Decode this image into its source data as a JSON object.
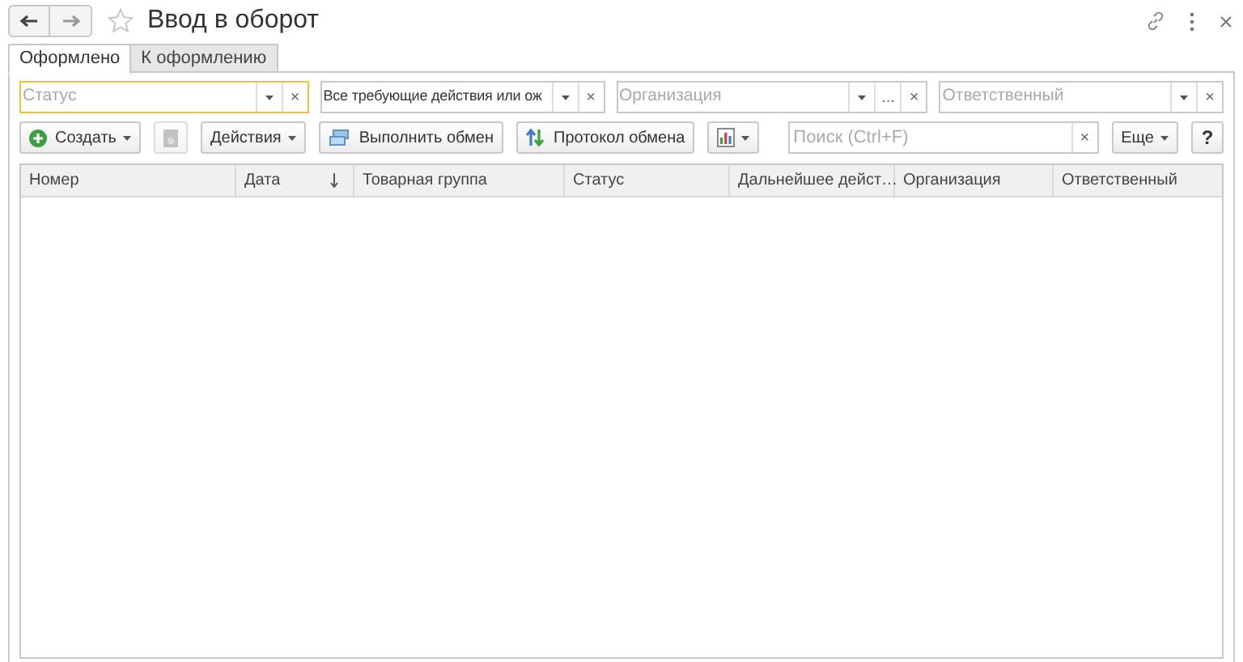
{
  "window": {
    "title": "Ввод в оборот"
  },
  "tabs": [
    {
      "label": "Оформлено",
      "selected": true
    },
    {
      "label": "К оформлению",
      "selected": false
    }
  ],
  "filters": [
    {
      "placeholder": "Статус",
      "focused": true,
      "buttons": [
        {
          "kind": "dropdown"
        },
        {
          "kind": "clear",
          "label": "×"
        }
      ]
    },
    {
      "value": "Все требующие действия или ож",
      "focused": false,
      "buttons": [
        {
          "kind": "dropdown"
        },
        {
          "kind": "clear",
          "label": "×"
        }
      ]
    },
    {
      "placeholder": "Организация",
      "focused": false,
      "buttons": [
        {
          "kind": "dropdown"
        },
        {
          "kind": "choose",
          "label": "..."
        },
        {
          "kind": "clear",
          "label": "×"
        }
      ]
    },
    {
      "placeholder": "Ответственный",
      "focused": false,
      "buttons": [
        {
          "kind": "dropdown"
        },
        {
          "kind": "clear",
          "label": "×"
        }
      ]
    }
  ],
  "toolbar": [
    {
      "kind": "create",
      "label": "Создать",
      "menu": true
    },
    {
      "kind": "copy",
      "disabled": true
    },
    {
      "kind": "text",
      "label": "Действия",
      "menu": true
    },
    {
      "kind": "exchange",
      "label": "Выполнить обмен"
    },
    {
      "kind": "protocol",
      "label": "Протокол обмена"
    },
    {
      "kind": "report",
      "menu": true
    },
    {
      "kind": "search",
      "placeholder": "Поиск (Ctrl+F)",
      "clear": "×"
    },
    {
      "kind": "text",
      "label": "Еще",
      "menu": true
    },
    {
      "kind": "help",
      "label": "?"
    }
  ],
  "table": {
    "columns": [
      {
        "label": "Номер",
        "sorted": false
      },
      {
        "label": "Дата",
        "sorted": true
      },
      {
        "label": "Товарная группа",
        "sorted": false
      },
      {
        "label": "Статус",
        "sorted": false
      },
      {
        "label": "Дальнейшее дейст…",
        "sorted": false
      },
      {
        "label": "Организация",
        "sorted": false
      },
      {
        "label": "Ответственный",
        "sorted": false
      }
    ]
  }
}
